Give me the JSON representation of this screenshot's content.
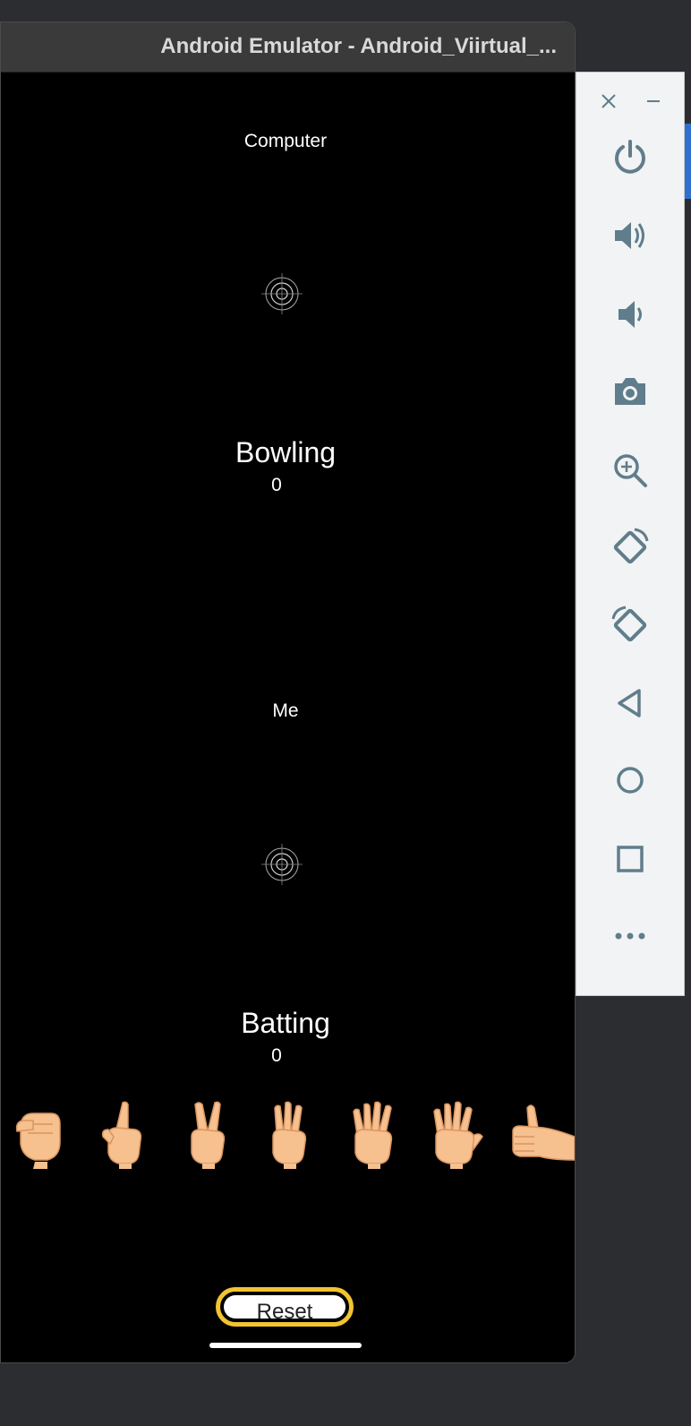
{
  "window": {
    "title": "Android Emulator - Android_Viirtual_..."
  },
  "game": {
    "computer_label": "Computer",
    "computer_mode": "Bowling",
    "computer_score": "0",
    "me_label": "Me",
    "me_mode": "Batting",
    "me_score": "0",
    "reset_label": "Reset",
    "hand_options": [
      "fist-0",
      "one-finger",
      "two-fingers",
      "three-fingers",
      "four-fingers",
      "five-fingers",
      "thumbs-up"
    ]
  },
  "side_panel": {
    "icons": [
      "power-icon",
      "volume-up-icon",
      "volume-down-icon",
      "camera-icon",
      "zoom-icon",
      "rotate-left-icon",
      "rotate-right-icon",
      "back-icon",
      "home-icon",
      "overview-icon",
      "more-icon"
    ]
  },
  "colors": {
    "accent": "#f2c431",
    "panel_icon": "#607d8b",
    "skin": "#f6c08f"
  }
}
